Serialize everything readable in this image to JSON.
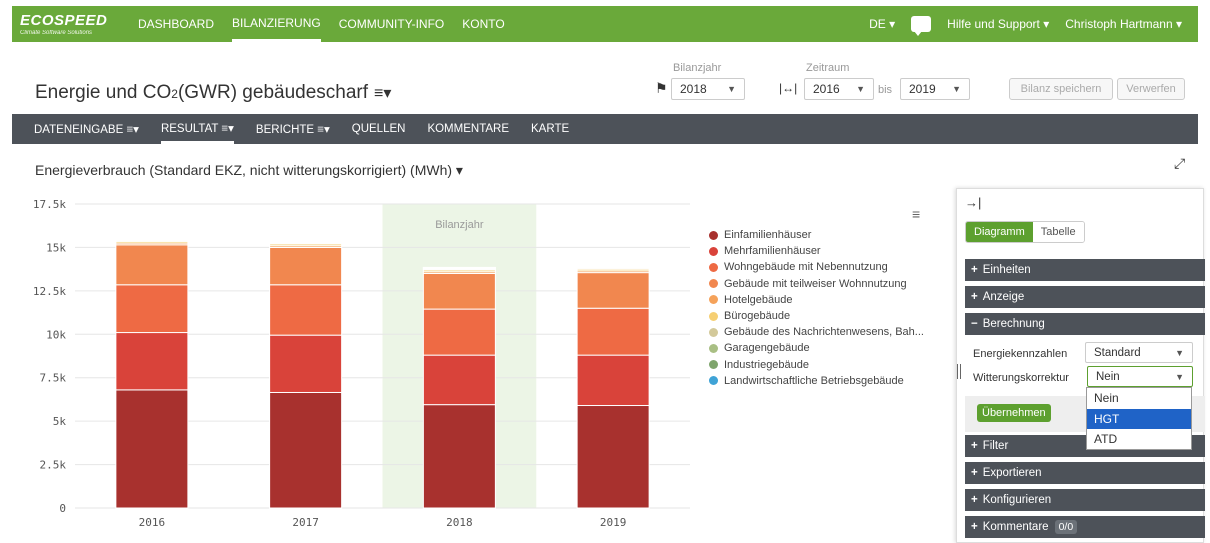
{
  "topnav": {
    "logo_main": "ECOSPEED",
    "logo_sub": "Climate Software Solutions",
    "items": [
      "DASHBOARD",
      "BILANZIERUNG",
      "COMMUNITY-INFO",
      "KONTO"
    ],
    "active_index": 1,
    "language": "DE ▾",
    "help": "Hilfe und Support ▾",
    "user": "Christoph Hartmann ▾"
  },
  "header": {
    "breadcrumb": " ",
    "title_pre": "Energie und CO",
    "title_sub": "2",
    "title_post": " (GWR) gebäudescharf",
    "menu_glyph": "≡▾",
    "bilanzjahr_label": "Bilanzjahr",
    "bilanzjahr_value": "2018",
    "zeitraum_label": "Zeitraum",
    "zeitraum_from": "2016",
    "zeitraum_bis": "bis",
    "zeitraum_to": "2019",
    "save_label": "Bilanz speichern",
    "discard_label": "Verwerfen"
  },
  "subnav": {
    "items": [
      "DATENEINGABE ≡▾",
      "RESULTAT ≡▾",
      "BERICHTE ≡▾",
      "QUELLEN",
      "KOMMENTARE",
      "KARTE"
    ],
    "active_index": 1
  },
  "chart_title": "Energieverbrauch (Standard EKZ, nicht witterungskorrigiert) (MWh) ▾",
  "chart_data": {
    "type": "bar",
    "stacked": true,
    "categories": [
      "2016",
      "2017",
      "2018",
      "2019"
    ],
    "ylim": [
      0,
      17500
    ],
    "yticks": [
      0,
      2500,
      5000,
      7500,
      10000,
      12500,
      15000,
      17500
    ],
    "ytick_labels": [
      "0",
      "2.5k",
      "5k",
      "7.5k",
      "10k",
      "12.5k",
      "15k",
      "17.5k"
    ],
    "highlight_category": "2018",
    "highlight_label": "Bilanzjahr",
    "legend_position": "right",
    "series": [
      {
        "name": "Einfamilienhäuser",
        "color": "#a8312e",
        "values": [
          6800,
          6650,
          5950,
          5900
        ]
      },
      {
        "name": "Mehrfamilienhäuser",
        "color": "#d9433a",
        "values": [
          3300,
          3300,
          2850,
          2900
        ]
      },
      {
        "name": "Wohngebäude mit Nebennutzung",
        "color": "#ee6a44",
        "values": [
          2750,
          2900,
          2650,
          2700
        ]
      },
      {
        "name": "Gebäude mit teilweiser Wohnnutzung",
        "color": "#f1874f",
        "values": [
          2300,
          2150,
          2050,
          2050
        ]
      },
      {
        "name": "Hotelgebäude",
        "color": "#f5a25a",
        "values": [
          100,
          100,
          100,
          100
        ]
      },
      {
        "name": "Bürogebäude",
        "color": "#f6cf73",
        "values": [
          100,
          100,
          100,
          100
        ]
      },
      {
        "name": "Gebäude des Nachrichtenwesens, Bah...",
        "color": "#d3c99a",
        "values": [
          60,
          60,
          60,
          60
        ]
      },
      {
        "name": "Garagengebäude",
        "color": "#a9bf84",
        "values": [
          40,
          40,
          40,
          40
        ]
      },
      {
        "name": "Industriegebäude",
        "color": "#7fa56d",
        "values": [
          40,
          40,
          40,
          40
        ]
      },
      {
        "name": "Landwirtschaftliche Betriebsgebäude",
        "color": "#3fa3d6",
        "values": [
          10,
          10,
          10,
          10
        ]
      }
    ]
  },
  "panel": {
    "toggle_diagram": "Diagramm",
    "toggle_table": "Tabelle",
    "sections": {
      "einheiten": "Einheiten",
      "anzeige": "Anzeige",
      "berechnung": "Berechnung",
      "filter": "Filter",
      "exportieren": "Exportieren",
      "konfigurieren": "Konfigurieren",
      "kommentare": "Kommentare",
      "kommentare_badge": "0/0"
    },
    "energiekennzahlen_label": "Energiekennzahlen",
    "energiekennzahlen_value": "Standard",
    "witterung_label": "Witterungskorrektur",
    "witterung_value": "Nein",
    "apply_label": "Übernehmen",
    "dropdown_options": [
      "Nein",
      "HGT",
      "ATD"
    ],
    "dropdown_highlight": 1
  }
}
